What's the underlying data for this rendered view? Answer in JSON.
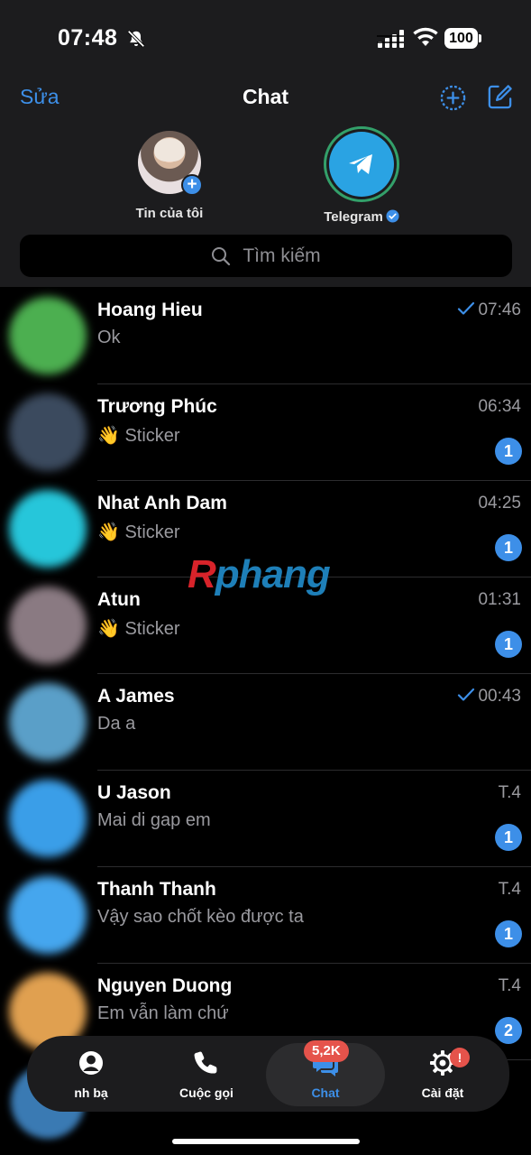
{
  "status_bar": {
    "time": "07:48",
    "battery": "100"
  },
  "nav": {
    "edit_label": "Sửa",
    "title": "Chat"
  },
  "stories": [
    {
      "label": "Tin của tôi"
    },
    {
      "label": "Telegram"
    }
  ],
  "search": {
    "placeholder": "Tìm kiếm"
  },
  "chats": [
    {
      "name": "Hoang Hieu",
      "preview": "Ok",
      "time": "07:46",
      "read": true,
      "unread": ""
    },
    {
      "name": "Trương Phúc",
      "preview": "👋 Sticker",
      "time": "06:34",
      "read": false,
      "unread": "1"
    },
    {
      "name": "Nhat Anh Dam",
      "preview": "👋 Sticker",
      "time": "04:25",
      "read": false,
      "unread": "1"
    },
    {
      "name": "Atun",
      "preview": "👋 Sticker",
      "time": "01:31",
      "read": false,
      "unread": "1"
    },
    {
      "name": "A James",
      "preview": "Da a",
      "time": "00:43",
      "read": true,
      "unread": ""
    },
    {
      "name": "U Jason",
      "preview": "Mai di gap em",
      "time": "T.4",
      "read": false,
      "unread": "1"
    },
    {
      "name": "Thanh Thanh",
      "preview": "Vậy sao chốt kèo được ta",
      "time": "T.4",
      "read": false,
      "unread": "1"
    },
    {
      "name": "Nguyen Duong",
      "preview": "Em vẫn làm chứ",
      "time": "T.4",
      "read": false,
      "unread": "2"
    }
  ],
  "avatar_colors": [
    "#4caf50",
    "#3b4a5e",
    "#26c6da",
    "#8a7a82",
    "#5a9fc8",
    "#3a9ee8",
    "#45a6ee",
    "#e0a050"
  ],
  "watermark": {
    "part1": "R",
    "part2": "phang"
  },
  "tabs": {
    "contacts_label": "nh bạ",
    "calls_label": "Cuộc gọi",
    "chats_label": "Chat",
    "chats_badge": "5,2K",
    "settings_label": "Cài đặt",
    "settings_badge": "!"
  },
  "colors": {
    "accent": "#3d8fe8",
    "badge_red": "#e5534b",
    "background": "#000000",
    "header": "#1c1c1e"
  }
}
